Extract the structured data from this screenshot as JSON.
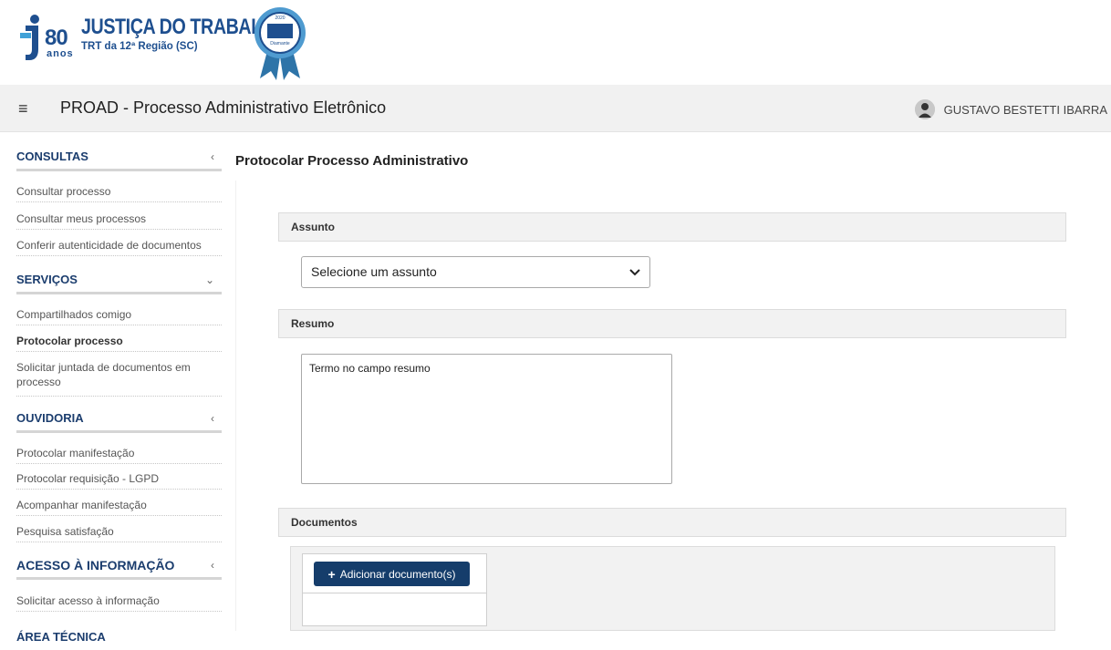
{
  "brand": {
    "logo_number": "80",
    "logo_small": "anos",
    "title": "JUSTIÇA DO TRABALHO",
    "subtitle": "TRT da 12ª Região (SC)",
    "seal_year": "2020",
    "seal_badge": "Diamante"
  },
  "topbar": {
    "menu_icon": "hamburger-icon",
    "app_title": "PROAD - Processo Administrativo Eletrônico",
    "user_name": "GUSTAVO BESTETTI IBARRA",
    "avatar_icon": "user-avatar-icon"
  },
  "sidebar": {
    "sections": [
      {
        "title": "CONSULTAS",
        "chevron": "‹",
        "items": [
          "Consultar processo",
          "Consultar meus processos",
          "Conferir autenticidade de documentos"
        ]
      },
      {
        "title": "SERVIÇOS",
        "chevron": "⌄",
        "items": [
          "Compartilhados comigo",
          "Protocolar processo",
          "Solicitar juntada de documentos em processo"
        ],
        "active_item": "Protocolar processo"
      },
      {
        "title": "OUVIDORIA",
        "chevron": "‹",
        "items": [
          "Protocolar manifestação",
          "Protocolar requisição - LGPD",
          "Acompanhar manifestação",
          "Pesquisa satisfação"
        ]
      },
      {
        "title": "ACESSO À INFORMAÇÃO",
        "chevron": "‹",
        "items": [
          "Solicitar acesso à informação"
        ]
      },
      {
        "title": "ÁREA TÉCNICA"
      }
    ]
  },
  "main": {
    "page_title": "Protocolar Processo Administrativo",
    "assunto": {
      "label": "Assunto",
      "select_value": "Selecione um assunto"
    },
    "resumo": {
      "label": "Resumo",
      "value": "Termo no campo resumo"
    },
    "documentos": {
      "label": "Documentos",
      "add_button": "Adicionar documento(s)"
    }
  },
  "colors": {
    "brand_blue": "#1e4f8f",
    "nav_blue": "#1b3d6e",
    "button_blue": "#153d6b"
  }
}
